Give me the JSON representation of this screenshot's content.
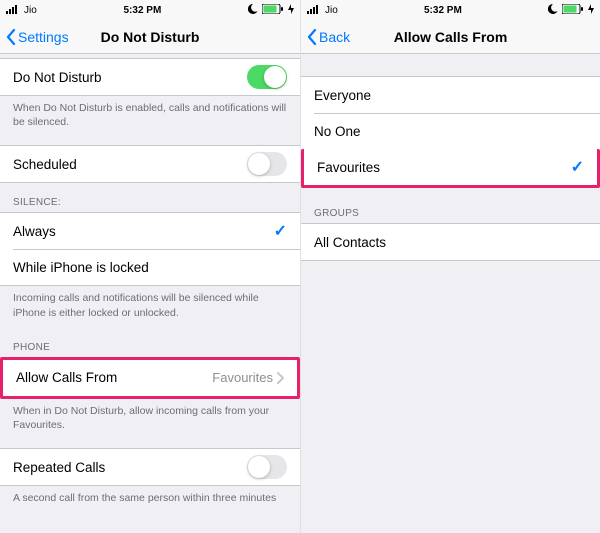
{
  "left": {
    "status": {
      "carrier": "Jio",
      "time": "5:32 PM"
    },
    "nav": {
      "back": "Settings",
      "title": "Do Not Disturb"
    },
    "dnd": {
      "label": "Do Not Disturb",
      "on": true
    },
    "dnd_footer": "When Do Not Disturb is enabled, calls and notifications will be silenced.",
    "scheduled": {
      "label": "Scheduled",
      "on": false
    },
    "silence_header": "SILENCE:",
    "silence": {
      "always": "Always",
      "locked": "While iPhone is locked"
    },
    "silence_footer": "Incoming calls and notifications will be silenced while iPhone is either locked or unlocked.",
    "phone_header": "PHONE",
    "allow": {
      "label": "Allow Calls From",
      "value": "Favourites"
    },
    "allow_footer": "When in Do Not Disturb, allow incoming calls from your Favourites.",
    "repeated": {
      "label": "Repeated Calls",
      "on": false
    },
    "repeated_footer": "A second call from the same person within three minutes"
  },
  "right": {
    "status": {
      "carrier": "Jio",
      "time": "5:32 PM"
    },
    "nav": {
      "back": "Back",
      "title": "Allow Calls From"
    },
    "options": {
      "everyone": "Everyone",
      "noone": "No One",
      "favourites": "Favourites"
    },
    "groups_header": "GROUPS",
    "groups": {
      "all": "All Contacts"
    }
  }
}
